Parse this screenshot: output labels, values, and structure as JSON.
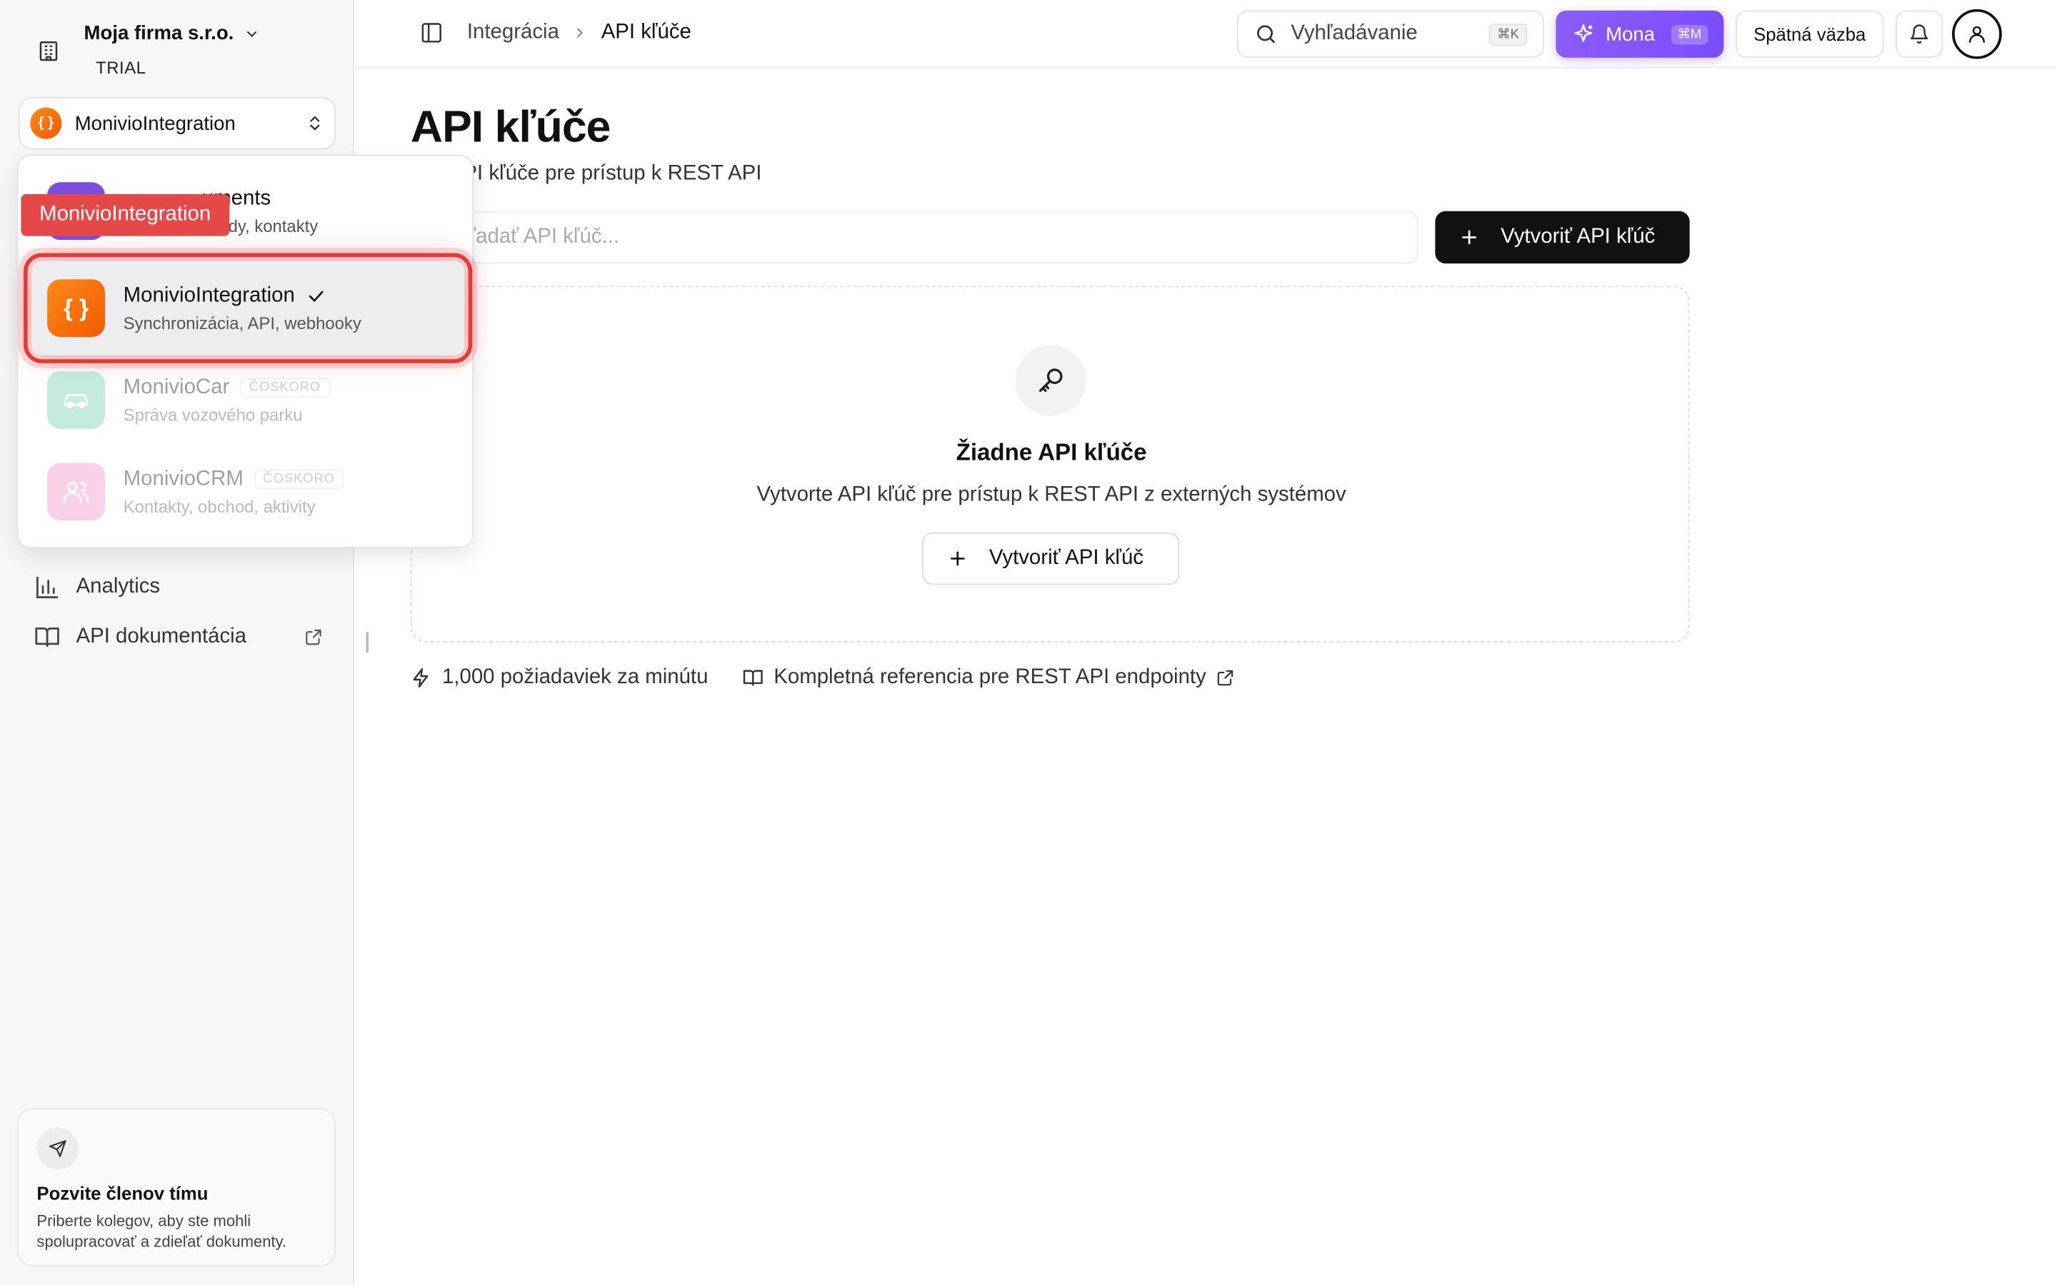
{
  "org": {
    "name": "Moja firma s.r.o.",
    "tier": "TRIAL"
  },
  "module_select": {
    "current": "MonivioIntegration",
    "icon": "{ }"
  },
  "sidebar": {
    "analytics": "Analytics",
    "api_docs": "API dokumentácia"
  },
  "dropdown": {
    "items": [
      {
        "title": "MonivioDocuments",
        "visible_title_fragment": "uments",
        "subtitle": "dy, kontakty"
      },
      {
        "title": "MonivioIntegration",
        "subtitle": "Synchronizácia, API, webhooky",
        "icon": "{ }",
        "selected": true
      },
      {
        "title": "MonivioCar",
        "subtitle": "Správa vozového parku",
        "badge": "ČOSKORO"
      },
      {
        "title": "MonivioCRM",
        "subtitle": "Kontakty, obchod, aktivity",
        "badge": "ČOSKORO"
      }
    ],
    "highlight_tag": "MonivioIntegration",
    "highlight_color": "#e53935"
  },
  "invite": {
    "title": "Pozvite členov tímu",
    "desc": "Priberte kolegov, aby ste mohli spolupracovať a zdieľať dokumenty."
  },
  "topbar": {
    "breadcrumb": [
      "Integrácia",
      "API kľúče"
    ],
    "search_label": "Vyhľadávanie",
    "search_kbd": "⌘K",
    "mona_label": "Mona",
    "mona_kbd": "⌘M",
    "feedback_label": "Spätná väzba"
  },
  "main": {
    "title": "API kľúče",
    "subtitle": "ujte API kľúče pre prístup k REST API",
    "search_placeholder": "ľadať API kľúč...",
    "create_label": "Vytvoriť API kľúč",
    "empty_title": "Žiadne API kľúče",
    "empty_desc": "Vytvorte API kľúč pre prístup k REST API z externých systémov",
    "empty_create_label": "Vytvoriť API kľúč",
    "rate_limit": "1,000 požiadaviek za minútu",
    "reference": "Kompletná referencia pre REST API endpointy"
  },
  "colors": {
    "accent_mona": "#7c4dff",
    "integration_orange": "#f06a00",
    "car_teal": "#6fcfb0",
    "crm_pink": "#f78fc8",
    "documents_purple": "#7b4de0"
  },
  "icons": [
    "building-icon",
    "chevron-down-icon",
    "chevrons-updown-icon",
    "check-icon",
    "car-icon",
    "users-icon",
    "bar-chart-icon",
    "book-icon",
    "external-link-icon",
    "send-icon",
    "panel-toggle-icon",
    "chevron-right-icon",
    "search-icon",
    "sparkles-icon",
    "bell-icon",
    "user-icon",
    "plus-icon",
    "key-icon",
    "zap-icon"
  ]
}
